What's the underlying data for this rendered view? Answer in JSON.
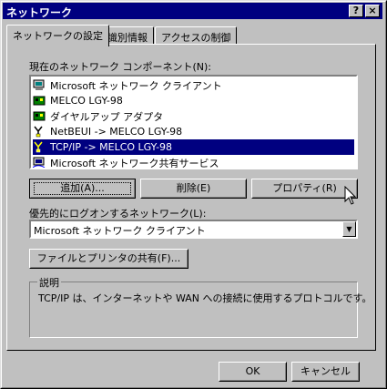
{
  "window": {
    "title": "ネットワーク",
    "help_btn": "?",
    "close_btn": "×"
  },
  "tabs": [
    {
      "label": "ネットワークの設定",
      "active": true
    },
    {
      "label": "識別情報",
      "active": false
    },
    {
      "label": "アクセスの制御",
      "active": false
    }
  ],
  "components": {
    "label": "現在のネットワーク コンポーネント(N):",
    "items": [
      {
        "icon": "client-computer-icon",
        "label": "Microsoft ネットワーク クライアント",
        "selected": false
      },
      {
        "icon": "network-adapter-icon",
        "label": "MELCO LGY-98",
        "selected": false
      },
      {
        "icon": "network-adapter-icon",
        "label": "ダイヤルアップ アダプタ",
        "selected": false
      },
      {
        "icon": "protocol-icon",
        "label": "NetBEUI -> MELCO LGY-98",
        "selected": false
      },
      {
        "icon": "protocol-icon",
        "label": "TCP/IP -> MELCO LGY-98",
        "selected": true
      },
      {
        "icon": "service-icon",
        "label": "Microsoft ネットワーク共有サービス",
        "selected": false
      }
    ]
  },
  "buttons": {
    "add": "追加(A)...",
    "remove": "削除(E)",
    "properties": "プロパティ(R)",
    "file_share": "ファイルとプリンタの共有(F)...",
    "ok": "OK",
    "cancel": "キャンセル"
  },
  "logon": {
    "label": "優先的にログオンするネットワーク(L):",
    "value": "Microsoft ネットワーク クライアント"
  },
  "description": {
    "legend": "説明",
    "text": "TCP/IP は、インターネットや WAN への接続に使用するプロトコルです。"
  },
  "colors": {
    "face": "#c0c0c0",
    "title_bar": "#000080",
    "selection": "#000080"
  }
}
